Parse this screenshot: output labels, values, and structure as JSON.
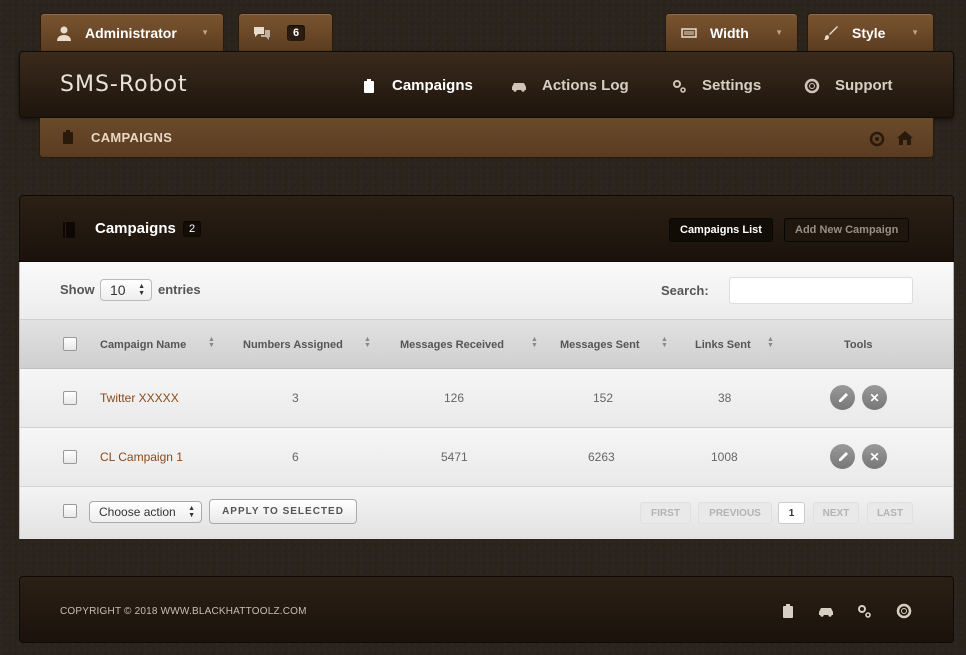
{
  "top_tabs": {
    "user_label": "Administrator",
    "messages_count": "6",
    "width_label": "Width",
    "style_label": "Style"
  },
  "nav": {
    "brand": "SMS-Robot",
    "items": [
      {
        "label": "Campaigns",
        "icon": "clipboard-icon",
        "active": true
      },
      {
        "label": "Actions Log",
        "icon": "car-icon",
        "active": false
      },
      {
        "label": "Settings",
        "icon": "gears-icon",
        "active": false
      },
      {
        "label": "Support",
        "icon": "lifebuoy-icon",
        "active": false
      }
    ]
  },
  "breadcrumb": {
    "label": "CAMPAIGNS"
  },
  "panel": {
    "title": "Campaigns",
    "count": "2",
    "list_button": "Campaigns List",
    "add_button": "Add New Campaign"
  },
  "table_controls": {
    "show_label": "Show",
    "entries_value": "10",
    "entries_label": "entries",
    "search_label": "Search:",
    "search_value": ""
  },
  "table": {
    "columns": [
      "Campaign Name",
      "Numbers Assigned",
      "Messages Received",
      "Messages Sent",
      "Links Sent",
      "Tools"
    ],
    "rows": [
      {
        "name": "Twitter XXXXX",
        "numbers": "3",
        "received": "126",
        "sent": "152",
        "links": "38"
      },
      {
        "name": "CL Campaign 1",
        "numbers": "6",
        "received": "5471",
        "sent": "6263",
        "links": "1008"
      }
    ]
  },
  "table_footer": {
    "action_select": "Choose action",
    "apply_label": "APPLY TO SELECTED",
    "pagination": {
      "first": "FIRST",
      "previous": "PREVIOUS",
      "current": "1",
      "next": "NEXT",
      "last": "LAST"
    }
  },
  "footer": {
    "copyright": "COPYRIGHT © 2018 WWW.BLACKHATTOOLZ.COM"
  },
  "colors": {
    "accent": "#6b4a2b",
    "link": "#8a4a1c",
    "dark": "#1a120b"
  }
}
